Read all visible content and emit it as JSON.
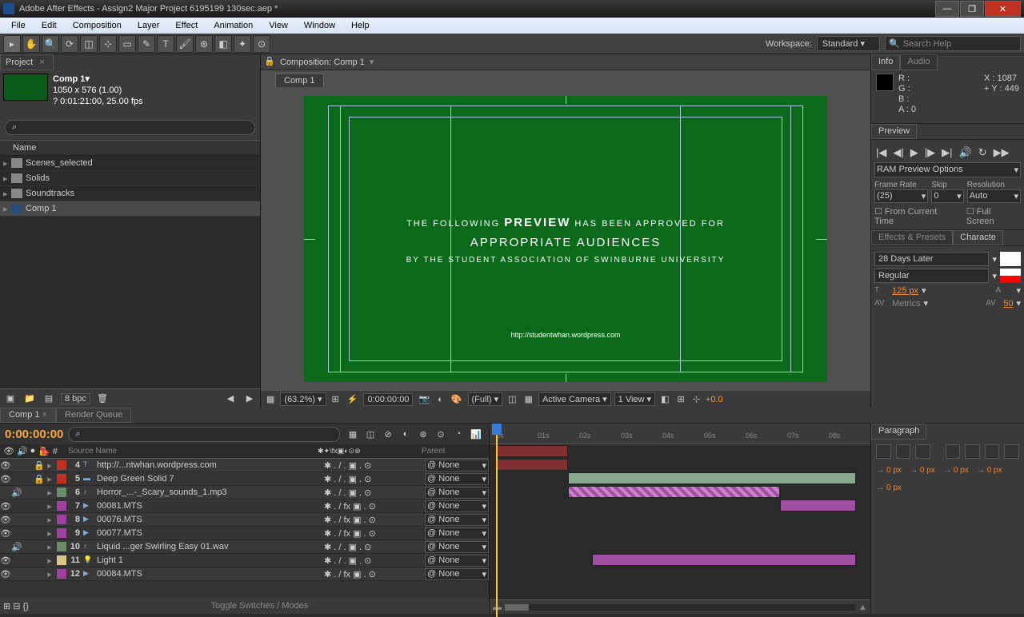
{
  "window": {
    "title": "Adobe After Effects - Assign2 Major Project 6195199 130sec.aep *"
  },
  "menu": [
    "File",
    "Edit",
    "Composition",
    "Layer",
    "Effect",
    "Animation",
    "View",
    "Window",
    "Help"
  ],
  "workspace": {
    "label": "Workspace:",
    "value": "Standard"
  },
  "search_help": "Search Help",
  "project": {
    "tab": "Project",
    "comp_name": "Comp 1▾",
    "dims": "1050 x 576 (1.00)",
    "duration": "? 0:01:21:00, 25.00 fps",
    "name_col": "Name",
    "items": [
      {
        "type": "folder",
        "label": "Scenes_selected"
      },
      {
        "type": "folder",
        "label": "Solids"
      },
      {
        "type": "folder",
        "label": "Soundtracks"
      },
      {
        "type": "comp",
        "label": "Comp 1",
        "selected": true
      }
    ],
    "bpc": "8 bpc"
  },
  "composition": {
    "header": "Composition: Comp 1",
    "tab": "Comp 1",
    "preview_text": {
      "line1a": "THE FOLLOWING ",
      "line1b": "PREVIEW",
      "line1c": " HAS BEEN APPROVED FOR",
      "line2": "APPROPRIATE AUDIENCES",
      "line3": "BY THE STUDENT ASSOCIATION OF SWINBURNE UNIVERSITY",
      "url": "http://studentwhan.wordpress.com"
    },
    "footer": {
      "zoom": "(63.2%)",
      "time": "0:00:00:00",
      "res": "(Full)",
      "camera": "Active Camera",
      "view": "1 View",
      "exp": "+0.0"
    }
  },
  "info": {
    "tab1": "Info",
    "tab2": "Audio",
    "r": "R :",
    "g": "G :",
    "b": "B :",
    "a": "A : 0",
    "x": "X : 1087",
    "y": "Y : 449"
  },
  "preview": {
    "tab": "Preview",
    "ram": "RAM Preview Options",
    "frame_rate_lbl": "Frame Rate",
    "frame_rate": "(25)",
    "skip_lbl": "Skip",
    "skip": "0",
    "res_lbl": "Resolution",
    "res": "Auto",
    "check1": "From Current Time",
    "check2": "Full Screen"
  },
  "effects_tab": "Effects & Presets",
  "character": {
    "tab": "Characte",
    "font": "28 Days Later",
    "style": "Regular",
    "size": "125 px",
    "leading": "",
    "kerning": "Metrics",
    "tracking": "50"
  },
  "paragraph": {
    "tab": "Paragraph",
    "vals": [
      "0 px",
      "0 px",
      "0 px",
      "0 px",
      "0 px"
    ]
  },
  "timeline": {
    "tab1": "Comp 1",
    "tab2": "Render Queue",
    "timecode": "0:00:00:00",
    "col_source": "Source Name",
    "col_parent": "Parent",
    "parent_none": "None",
    "toggle": "Toggle Switches / Modes",
    "ticks": [
      "0s",
      "01s",
      "02s",
      "03s",
      "04s",
      "05s",
      "06s",
      "07s",
      "08s"
    ],
    "layers": [
      {
        "num": 4,
        "color": "#c03020",
        "icon": "T",
        "name": "http://...ntwhan.wordpress.com",
        "eye": true,
        "lock": true
      },
      {
        "num": 5,
        "color": "#c03020",
        "icon": "solid",
        "name": "Deep Green Solid 7",
        "eye": true,
        "lock": true
      },
      {
        "num": 6,
        "color": "#6a8a6a",
        "icon": "audio",
        "name": "Horror_...-_Scary_sounds_1.mp3",
        "audio": true
      },
      {
        "num": 7,
        "color": "#a040a0",
        "icon": "video",
        "name": "00081.MTS",
        "eye": true,
        "fx": true
      },
      {
        "num": 8,
        "color": "#a040a0",
        "icon": "video",
        "name": "00076.MTS",
        "eye": true,
        "fx": true
      },
      {
        "num": 9,
        "color": "#a040a0",
        "icon": "video",
        "name": "00077.MTS",
        "eye": true,
        "fx": true
      },
      {
        "num": 10,
        "color": "#6a8a6a",
        "icon": "audio",
        "name": "Liquid ...ger Swirling Easy 01.wav",
        "audio": true
      },
      {
        "num": 11,
        "color": "#d8c888",
        "icon": "light",
        "name": "Light 1",
        "eye": true
      },
      {
        "num": 12,
        "color": "#a040a0",
        "icon": "video",
        "name": "00084.MTS",
        "eye": true,
        "fx": true
      }
    ],
    "tracks": [
      {
        "layer": 0,
        "start": 0,
        "end": 90,
        "color": "#803030"
      },
      {
        "layer": 1,
        "start": 0,
        "end": 90,
        "color": "#803030"
      },
      {
        "layer": 2,
        "start": 90,
        "end": 450,
        "color": "#8aa890"
      },
      {
        "layer": 3,
        "start": 90,
        "end": 355,
        "color": "#a050a0",
        "stripe": true
      },
      {
        "layer": 4,
        "start": 355,
        "end": 450,
        "color": "#a050a0"
      },
      {
        "layer": 8,
        "start": 120,
        "end": 450,
        "color": "#a050a0"
      }
    ]
  }
}
